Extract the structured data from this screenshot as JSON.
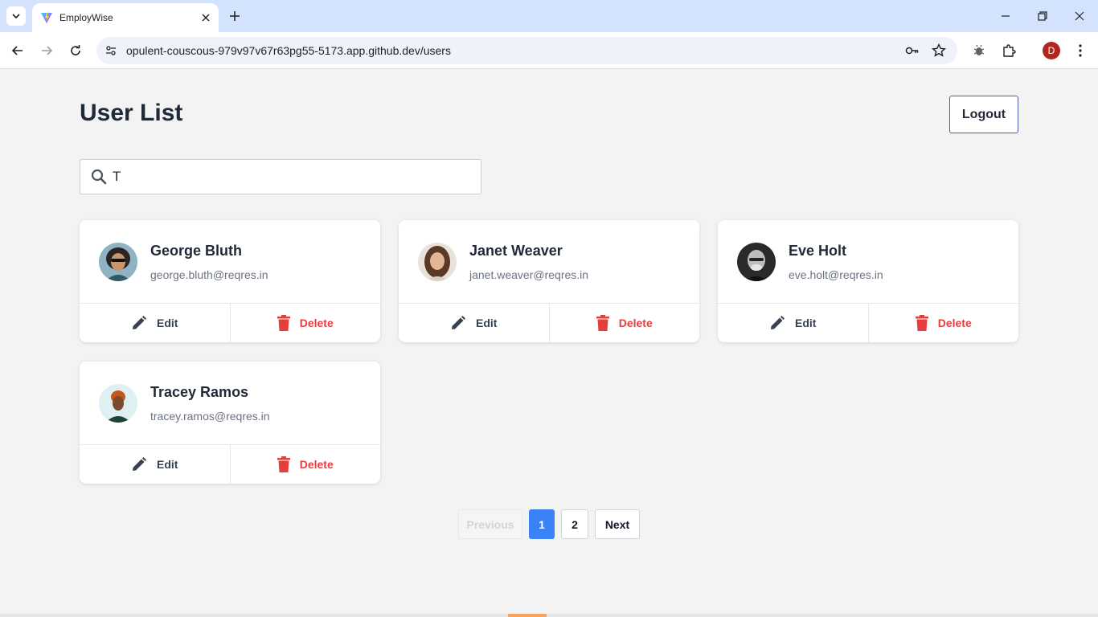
{
  "browser": {
    "tab_title": "EmployWise",
    "url": "opulent-couscous-979v97v67r63pg55-5173.app.github.dev/users",
    "profile_initial": "D",
    "icons": [
      "tab-search-icon",
      "vite-logo-icon",
      "close-icon",
      "plus-icon",
      "minimize-icon",
      "restore-icon",
      "close-window-icon",
      "back-icon",
      "forward-icon",
      "reload-icon",
      "site-info-icon",
      "password-key-icon",
      "star-icon",
      "extension-bug-icon",
      "puzzle-icon",
      "kebab-menu-icon"
    ]
  },
  "page": {
    "title": "User List",
    "logout_label": "Logout",
    "search": {
      "value": "T",
      "placeholder": ""
    }
  },
  "users": [
    {
      "name": "George Bluth",
      "email": "george.bluth@reqres.in",
      "edit_label": "Edit",
      "delete_label": "Delete"
    },
    {
      "name": "Janet Weaver",
      "email": "janet.weaver@reqres.in",
      "edit_label": "Edit",
      "delete_label": "Delete"
    },
    {
      "name": "Eve Holt",
      "email": "eve.holt@reqres.in",
      "edit_label": "Edit",
      "delete_label": "Delete"
    },
    {
      "name": "Tracey Ramos",
      "email": "tracey.ramos@reqres.in",
      "edit_label": "Edit",
      "delete_label": "Delete"
    }
  ],
  "pagination": {
    "previous_label": "Previous",
    "pages": [
      "1",
      "2"
    ],
    "current_page": "1",
    "next_label": "Next"
  },
  "colors": {
    "accent": "#3b82f6",
    "delete": "#e53e3e",
    "logout_border": "#4f5aa8",
    "tabstrip": "#d3e3fd"
  }
}
